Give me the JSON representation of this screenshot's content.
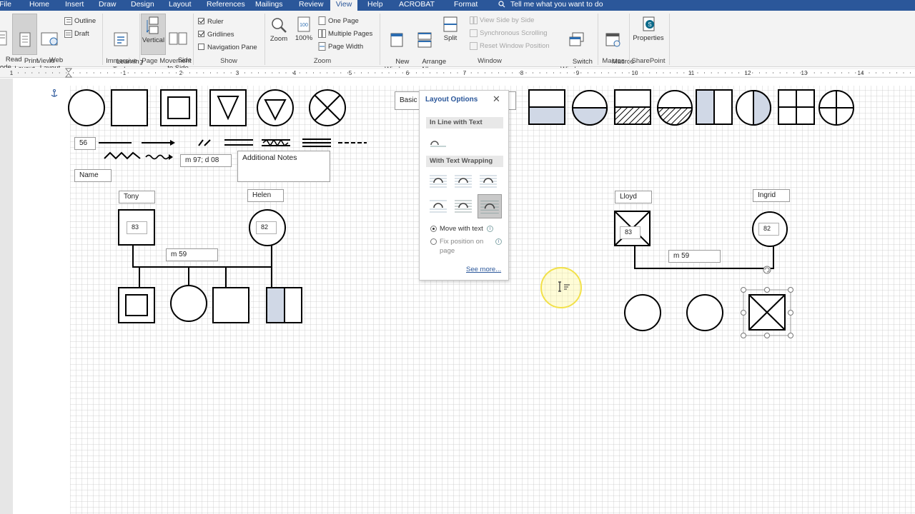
{
  "menu": {
    "tabs": [
      {
        "label": "File",
        "active": false
      },
      {
        "label": "Home",
        "active": false
      },
      {
        "label": "Insert",
        "active": false
      },
      {
        "label": "Draw",
        "active": false
      },
      {
        "label": "Design",
        "active": false
      },
      {
        "label": "Layout",
        "active": false
      },
      {
        "label": "References",
        "active": false
      },
      {
        "label": "Mailings",
        "active": false
      },
      {
        "label": "Review",
        "active": false
      },
      {
        "label": "View",
        "active": true
      },
      {
        "label": "Help",
        "active": false
      },
      {
        "label": "ACROBAT",
        "active": false
      },
      {
        "label": "Format",
        "active": false
      }
    ],
    "tell_me": "Tell me what you want to do"
  },
  "ribbon": {
    "views": {
      "read_mode": "Read\nMode",
      "print_layout": "Print\nLayout",
      "web_layout": "Web\nLayout",
      "outline": "Outline",
      "draft": "Draft",
      "group": "Views"
    },
    "immersive": {
      "learning_tools": "Learning\nTools",
      "group": "Immersive"
    },
    "page_movement": {
      "vertical": "Vertical",
      "side_to_side": "Side\nto Side",
      "group": "Page Movement"
    },
    "show": {
      "ruler": "Ruler",
      "gridlines": "Gridlines",
      "navigation_pane": "Navigation Pane",
      "ruler_checked": true,
      "gridlines_checked": true,
      "navigation_checked": false,
      "group": "Show"
    },
    "zoom": {
      "zoom": "Zoom",
      "hundred": "100%",
      "one_page": "One Page",
      "multiple_pages": "Multiple Pages",
      "page_width": "Page Width",
      "group": "Zoom"
    },
    "window": {
      "new_window": "New\nWindow",
      "arrange_all": "Arrange\nAll",
      "split": "Split",
      "view_side_by_side": "View Side by Side",
      "sync_scrolling": "Synchronous Scrolling",
      "reset_window": "Reset Window Position",
      "switch_windows": "Switch\nWindows ▾",
      "group": "Window"
    },
    "macros": {
      "macros": "Macros\n▾",
      "group": "Macros"
    },
    "sharepoint": {
      "properties": "Properties",
      "group": "SharePoint"
    }
  },
  "ruler": {
    "numbers": [
      "1",
      "1",
      "2",
      "3",
      "4",
      "5",
      "6",
      "7",
      "8",
      "9",
      "10",
      "11",
      "12",
      "13",
      "14"
    ]
  },
  "document": {
    "legend_boxes": {
      "age": "56",
      "name": "Name",
      "marriage": "m 97; d 08",
      "notes": "Additional Notes",
      "basic": "Basic"
    },
    "family_left": {
      "father_name": "Tony",
      "father_age": "83",
      "mother_name": "Helen",
      "mother_age": "82",
      "marriage": "m 59"
    },
    "family_right": {
      "father_name": "Lloyd",
      "father_age": "83",
      "mother_name": "Ingrid",
      "mother_age": "82",
      "marriage": "m 59"
    }
  },
  "layout_options": {
    "title": "Layout Options",
    "close": "✕",
    "inline_heading": "In Line with Text",
    "wrapping_heading": "With Text Wrapping",
    "move_with_text": "Move with text",
    "fix_position": "Fix position on\npage",
    "move_with_text_selected": true,
    "see_more": "See more..."
  },
  "colors": {
    "title_bar": "#2b579a",
    "ribbon_bg": "#f3f3f3",
    "shape_fill": "#d0d8e6",
    "grid": "#c8c8c8",
    "cursor_highlight": "#f2e14a"
  }
}
